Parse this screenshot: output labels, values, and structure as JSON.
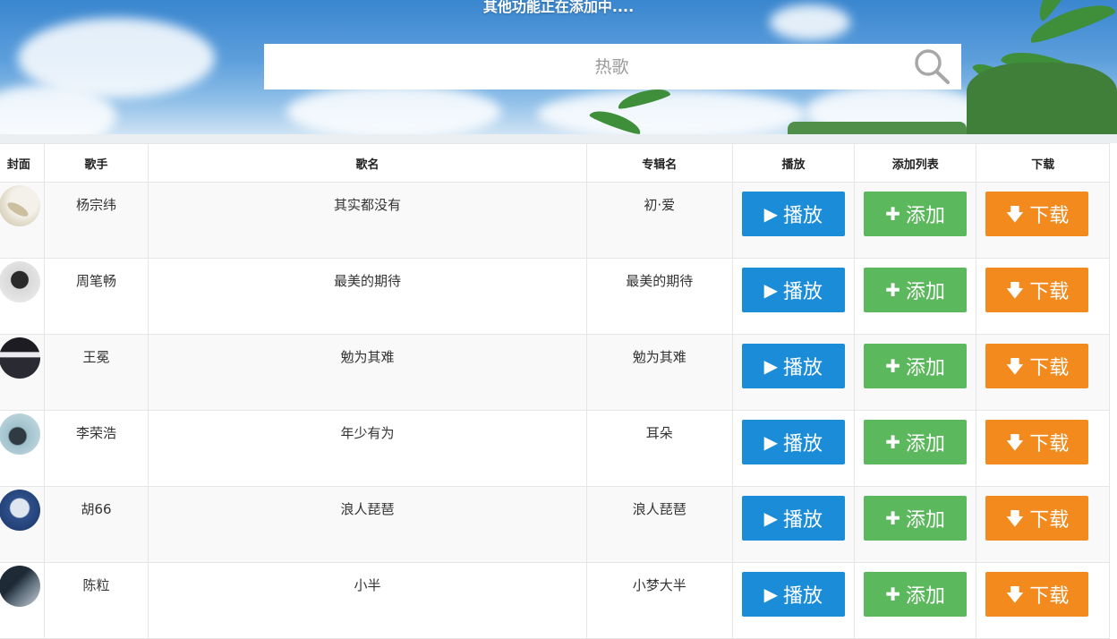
{
  "header": {
    "notice": "其他功能正在添加中...."
  },
  "search": {
    "placeholder": "热歌"
  },
  "table": {
    "columns": [
      "封面",
      "歌手",
      "歌名",
      "专辑名",
      "播放",
      "添加列表",
      "下载"
    ],
    "play_label": "播放",
    "add_label": "添加",
    "download_label": "下载",
    "rows": [
      {
        "singer": "杨宗纬",
        "song": "其实都没有",
        "album": "初·爱"
      },
      {
        "singer": "周笔畅",
        "song": "最美的期待",
        "album": "最美的期待"
      },
      {
        "singer": "王冕",
        "song": "勉为其难",
        "album": "勉为其难"
      },
      {
        "singer": "李荣浩",
        "song": "年少有为",
        "album": "耳朵"
      },
      {
        "singer": "胡66",
        "song": "浪人琵琶",
        "album": "浪人琵琶"
      },
      {
        "singer": "陈粒",
        "song": "小半",
        "album": "小梦大半"
      }
    ]
  },
  "colors": {
    "play": "#1a8cd8",
    "add": "#5cb85c",
    "download": "#f28a1e"
  },
  "icons": {
    "search": "magnifier-icon",
    "play": "play-triangle-icon",
    "add": "plus-icon",
    "download": "arrow-down-icon"
  }
}
